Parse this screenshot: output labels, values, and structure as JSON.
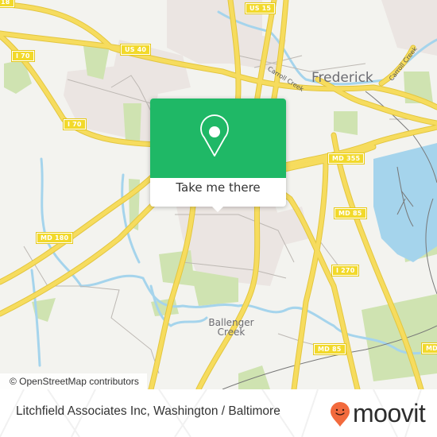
{
  "map": {
    "colors": {
      "background": "#f3f3ef",
      "road_major": "#f6dc5e",
      "road_outline": "#e3c63f",
      "water": "#a5d4ec",
      "park": "#cfe3b1",
      "urban": "#ebe5e2",
      "minor_road": "#b9b4b0",
      "railway": "#777777"
    },
    "place_labels": {
      "city": "Frederick",
      "neighborhood_line1": "Ballenger",
      "neighborhood_line2": "Creek"
    },
    "water_labels": {
      "creek_west": "Carroll Creek",
      "creek_east": "Carroll Creek"
    },
    "road_shields": [
      {
        "id": "us15",
        "label": "US 15"
      },
      {
        "id": "us40",
        "label": "US 40"
      },
      {
        "id": "i70_north",
        "label": "I 70"
      },
      {
        "id": "i70_south",
        "label": "I 70"
      },
      {
        "id": "md180",
        "label": "MD 180"
      },
      {
        "id": "md355",
        "label": "MD 355"
      },
      {
        "id": "md85_north",
        "label": "MD 85"
      },
      {
        "id": "i270",
        "label": "I 270"
      },
      {
        "id": "md85_south",
        "label": "MD 85"
      },
      {
        "id": "md_edge",
        "label": "MD"
      },
      {
        "id": "top_left_edge",
        "label": "18"
      }
    ]
  },
  "popup": {
    "icon": "location-pin-icon",
    "button_label": "Take me there",
    "accent_color": "#1fb866"
  },
  "attribution": {
    "text": "© OpenStreetMap contributors"
  },
  "footer": {
    "title": "Litchfield Associates Inc, Washington / Baltimore",
    "logo": {
      "icon": "moovit-smile-pin-icon",
      "wordmark": "moovit",
      "icon_color": "#f26a3d"
    }
  }
}
